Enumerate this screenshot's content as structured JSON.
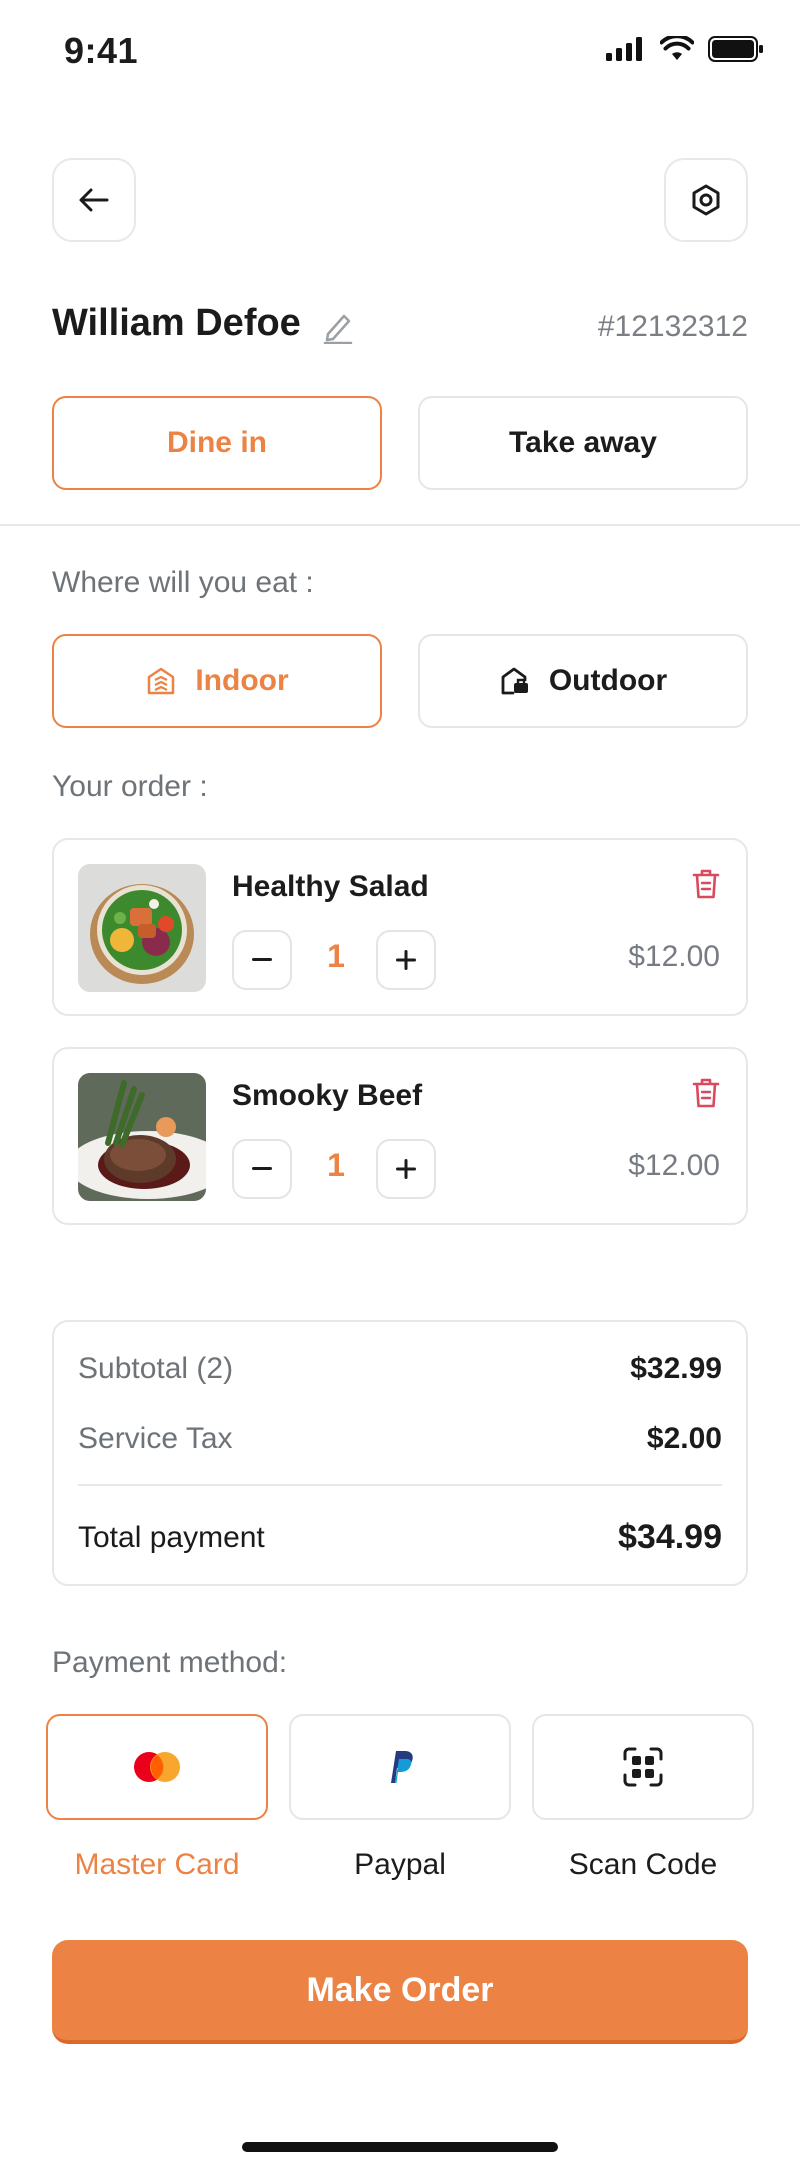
{
  "status_bar": {
    "time": "9:41"
  },
  "customer": {
    "name": "William Defoe",
    "order_id": "#12132312"
  },
  "order_type": {
    "options": [
      "Dine in",
      "Take away"
    ],
    "selected": "Dine in"
  },
  "seating": {
    "label": "Where will you eat :",
    "options": [
      {
        "label": "Indoor",
        "icon": "indoor-building-icon"
      },
      {
        "label": "Outdoor",
        "icon": "outdoor-house-icon"
      }
    ],
    "selected": "Indoor"
  },
  "order": {
    "label": "Your order :",
    "items": [
      {
        "name": "Healthy Salad",
        "quantity": "1",
        "price": "$12.00",
        "image": "salad-bowl"
      },
      {
        "name": "Smooky Beef",
        "quantity": "1",
        "price": "$12.00",
        "image": "beef-steak"
      }
    ]
  },
  "summary": {
    "subtotal_label": "Subtotal (2)",
    "subtotal_value": "$32.99",
    "tax_label": "Service Tax",
    "tax_value": "$2.00",
    "total_label": "Total payment",
    "total_value": "$34.99"
  },
  "payment": {
    "label": "Payment method:",
    "methods": [
      {
        "label": "Master Card",
        "icon": "mastercard-icon"
      },
      {
        "label": "Paypal",
        "icon": "paypal-icon"
      },
      {
        "label": "Scan Code",
        "icon": "scan-code-icon"
      }
    ],
    "selected": "Master Card"
  },
  "actions": {
    "make_order": "Make Order"
  },
  "colors": {
    "accent": "#ec8244",
    "muted_text": "#6e7378",
    "border": "#e5e7ea",
    "danger": "#d94a5f"
  }
}
